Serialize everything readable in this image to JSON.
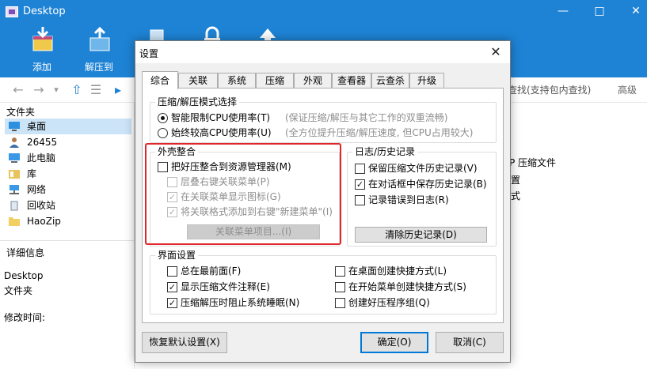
{
  "main_window": {
    "title": "Desktop",
    "toolbar": [
      {
        "label": "添加",
        "icon": "add-archive-icon"
      },
      {
        "label": "解压到",
        "icon": "extract-icon"
      },
      {
        "label": "",
        "icon": "delete-icon"
      },
      {
        "label": "",
        "icon": "lock-icon"
      },
      {
        "label": "",
        "icon": "upload-icon"
      }
    ],
    "search_placeholder": "查找(支持包内查找)",
    "search_advanced": "高级",
    "sidebar": {
      "heading": "文件夹",
      "items": [
        {
          "label": "桌面",
          "icon": "desktop-icon"
        },
        {
          "label": "26455",
          "icon": "user-icon"
        },
        {
          "label": "此电脑",
          "icon": "computer-icon"
        },
        {
          "label": "库",
          "icon": "library-icon"
        },
        {
          "label": "网络",
          "icon": "network-icon"
        },
        {
          "label": "回收站",
          "icon": "recycle-bin-icon"
        },
        {
          "label": "HaoZip",
          "icon": "folder-icon"
        }
      ],
      "details_heading": "详细信息",
      "details_name": "Desktop",
      "details_type": "文件夹",
      "details_modified": "修改时间:"
    },
    "right_panel": {
      "line1": "P 压缩文件",
      "line2": "置",
      "line3": "式"
    }
  },
  "dialog": {
    "title": "设置",
    "tabs": [
      "综合",
      "关联",
      "系统",
      "压缩",
      "外观",
      "查看器",
      "云查杀",
      "升级"
    ],
    "active_tab": "综合",
    "mode_group": {
      "title": "压缩/解压模式选择",
      "options": [
        {
          "label": "智能限制CPU使用率(T)",
          "note": "(保证压缩/解压与其它工作的双重流畅)",
          "selected": true
        },
        {
          "label": "始终较高CPU使用率(U)",
          "note": "(全方位提升压缩/解压速度, 但CPU占用较大)",
          "selected": false
        }
      ]
    },
    "shell_group": {
      "title": "外壳整合",
      "main_option": {
        "label": "把好压整合到资源管理器(M)",
        "checked": false
      },
      "sub_options": [
        {
          "label": "层叠右键关联菜单(P)",
          "checked": false
        },
        {
          "label": "在关联菜单显示图标(G)",
          "checked": true
        },
        {
          "label": "将关联格式添加到右键\"新建菜单\"(I)",
          "checked": true
        }
      ],
      "button": "关联菜单项目...(I)"
    },
    "log_group": {
      "title": "日志/历史记录",
      "options": [
        {
          "label": "保留压缩文件历史记录(V)",
          "checked": false
        },
        {
          "label": "在对话框中保存历史记录(B)",
          "checked": true
        },
        {
          "label": "记录错误到日志(R)",
          "checked": false
        }
      ],
      "button": "清除历史记录(D)"
    },
    "ui_group": {
      "title": "界面设置",
      "left": [
        {
          "label": "总在最前面(F)",
          "checked": false
        },
        {
          "label": "显示压缩文件注释(E)",
          "checked": true
        },
        {
          "label": "压缩解压时阻止系统睡眠(N)",
          "checked": true
        }
      ],
      "right": [
        {
          "label": "在桌面创建快捷方式(L)",
          "checked": false
        },
        {
          "label": "在开始菜单创建快捷方式(S)",
          "checked": false
        },
        {
          "label": "创建好压程序组(Q)",
          "checked": false
        }
      ]
    },
    "buttons": {
      "restore": "恢复默认设置(X)",
      "ok": "确定(O)",
      "cancel": "取消(C)"
    }
  }
}
